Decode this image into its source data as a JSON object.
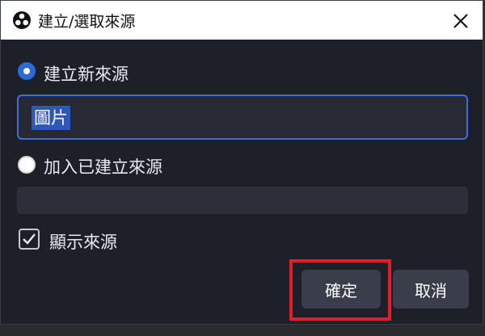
{
  "window": {
    "title": "建立/選取來源",
    "app_icon": "obs-logo-icon",
    "close_icon": "close-icon"
  },
  "create_new": {
    "label": "建立新來源",
    "selected": true,
    "input_value": "圖片"
  },
  "add_existing": {
    "label": "加入已建立來源",
    "selected": false,
    "select_value": ""
  },
  "show_source": {
    "label": "顯示來源",
    "checked": true
  },
  "buttons": {
    "ok_label": "確定",
    "cancel_label": "取消"
  },
  "colors": {
    "dialog_bg": "#1e2029",
    "accent": "#2d6ad6",
    "button_bg": "#3a3d4a",
    "highlight": "#e11f2a"
  }
}
